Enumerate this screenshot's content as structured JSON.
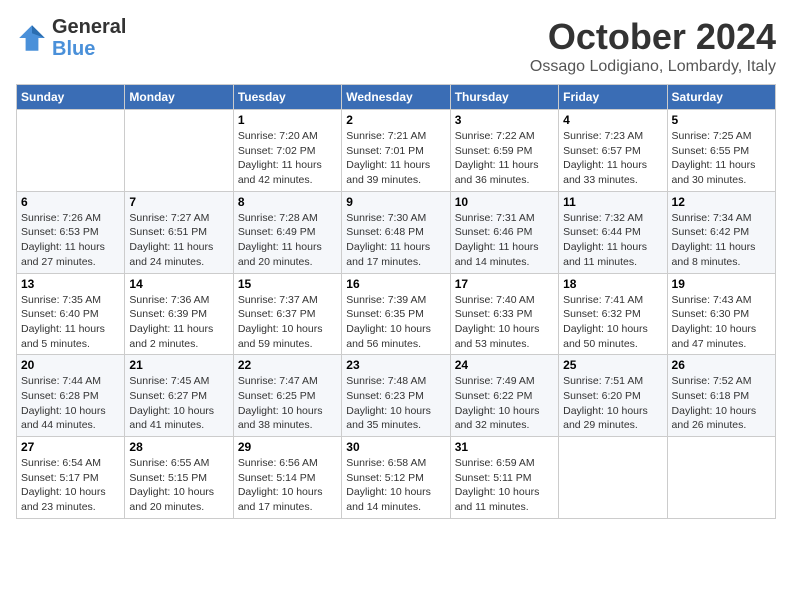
{
  "header": {
    "logo_line1": "General",
    "logo_line2": "Blue",
    "month": "October 2024",
    "location": "Ossago Lodigiano, Lombardy, Italy"
  },
  "weekdays": [
    "Sunday",
    "Monday",
    "Tuesday",
    "Wednesday",
    "Thursday",
    "Friday",
    "Saturday"
  ],
  "weeks": [
    [
      {
        "day": "",
        "info": ""
      },
      {
        "day": "",
        "info": ""
      },
      {
        "day": "1",
        "info": "Sunrise: 7:20 AM\nSunset: 7:02 PM\nDaylight: 11 hours and 42 minutes."
      },
      {
        "day": "2",
        "info": "Sunrise: 7:21 AM\nSunset: 7:01 PM\nDaylight: 11 hours and 39 minutes."
      },
      {
        "day": "3",
        "info": "Sunrise: 7:22 AM\nSunset: 6:59 PM\nDaylight: 11 hours and 36 minutes."
      },
      {
        "day": "4",
        "info": "Sunrise: 7:23 AM\nSunset: 6:57 PM\nDaylight: 11 hours and 33 minutes."
      },
      {
        "day": "5",
        "info": "Sunrise: 7:25 AM\nSunset: 6:55 PM\nDaylight: 11 hours and 30 minutes."
      }
    ],
    [
      {
        "day": "6",
        "info": "Sunrise: 7:26 AM\nSunset: 6:53 PM\nDaylight: 11 hours and 27 minutes."
      },
      {
        "day": "7",
        "info": "Sunrise: 7:27 AM\nSunset: 6:51 PM\nDaylight: 11 hours and 24 minutes."
      },
      {
        "day": "8",
        "info": "Sunrise: 7:28 AM\nSunset: 6:49 PM\nDaylight: 11 hours and 20 minutes."
      },
      {
        "day": "9",
        "info": "Sunrise: 7:30 AM\nSunset: 6:48 PM\nDaylight: 11 hours and 17 minutes."
      },
      {
        "day": "10",
        "info": "Sunrise: 7:31 AM\nSunset: 6:46 PM\nDaylight: 11 hours and 14 minutes."
      },
      {
        "day": "11",
        "info": "Sunrise: 7:32 AM\nSunset: 6:44 PM\nDaylight: 11 hours and 11 minutes."
      },
      {
        "day": "12",
        "info": "Sunrise: 7:34 AM\nSunset: 6:42 PM\nDaylight: 11 hours and 8 minutes."
      }
    ],
    [
      {
        "day": "13",
        "info": "Sunrise: 7:35 AM\nSunset: 6:40 PM\nDaylight: 11 hours and 5 minutes."
      },
      {
        "day": "14",
        "info": "Sunrise: 7:36 AM\nSunset: 6:39 PM\nDaylight: 11 hours and 2 minutes."
      },
      {
        "day": "15",
        "info": "Sunrise: 7:37 AM\nSunset: 6:37 PM\nDaylight: 10 hours and 59 minutes."
      },
      {
        "day": "16",
        "info": "Sunrise: 7:39 AM\nSunset: 6:35 PM\nDaylight: 10 hours and 56 minutes."
      },
      {
        "day": "17",
        "info": "Sunrise: 7:40 AM\nSunset: 6:33 PM\nDaylight: 10 hours and 53 minutes."
      },
      {
        "day": "18",
        "info": "Sunrise: 7:41 AM\nSunset: 6:32 PM\nDaylight: 10 hours and 50 minutes."
      },
      {
        "day": "19",
        "info": "Sunrise: 7:43 AM\nSunset: 6:30 PM\nDaylight: 10 hours and 47 minutes."
      }
    ],
    [
      {
        "day": "20",
        "info": "Sunrise: 7:44 AM\nSunset: 6:28 PM\nDaylight: 10 hours and 44 minutes."
      },
      {
        "day": "21",
        "info": "Sunrise: 7:45 AM\nSunset: 6:27 PM\nDaylight: 10 hours and 41 minutes."
      },
      {
        "day": "22",
        "info": "Sunrise: 7:47 AM\nSunset: 6:25 PM\nDaylight: 10 hours and 38 minutes."
      },
      {
        "day": "23",
        "info": "Sunrise: 7:48 AM\nSunset: 6:23 PM\nDaylight: 10 hours and 35 minutes."
      },
      {
        "day": "24",
        "info": "Sunrise: 7:49 AM\nSunset: 6:22 PM\nDaylight: 10 hours and 32 minutes."
      },
      {
        "day": "25",
        "info": "Sunrise: 7:51 AM\nSunset: 6:20 PM\nDaylight: 10 hours and 29 minutes."
      },
      {
        "day": "26",
        "info": "Sunrise: 7:52 AM\nSunset: 6:18 PM\nDaylight: 10 hours and 26 minutes."
      }
    ],
    [
      {
        "day": "27",
        "info": "Sunrise: 6:54 AM\nSunset: 5:17 PM\nDaylight: 10 hours and 23 minutes."
      },
      {
        "day": "28",
        "info": "Sunrise: 6:55 AM\nSunset: 5:15 PM\nDaylight: 10 hours and 20 minutes."
      },
      {
        "day": "29",
        "info": "Sunrise: 6:56 AM\nSunset: 5:14 PM\nDaylight: 10 hours and 17 minutes."
      },
      {
        "day": "30",
        "info": "Sunrise: 6:58 AM\nSunset: 5:12 PM\nDaylight: 10 hours and 14 minutes."
      },
      {
        "day": "31",
        "info": "Sunrise: 6:59 AM\nSunset: 5:11 PM\nDaylight: 10 hours and 11 minutes."
      },
      {
        "day": "",
        "info": ""
      },
      {
        "day": "",
        "info": ""
      }
    ]
  ]
}
